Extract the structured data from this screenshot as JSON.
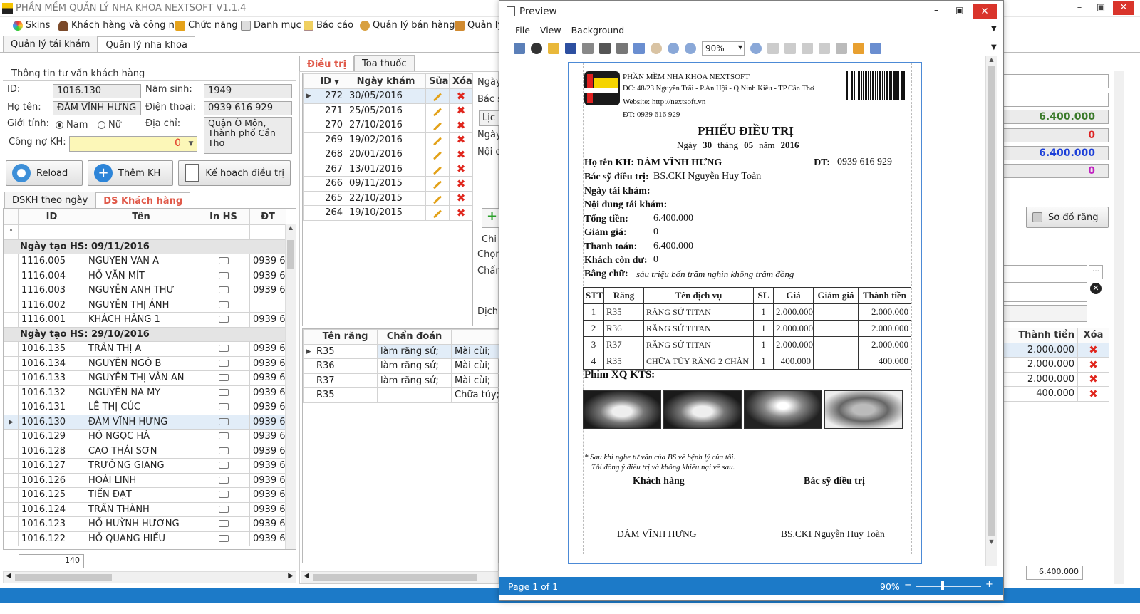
{
  "app": {
    "title": "PHẦN MỀM QUẢN LÝ NHA KHOA NEXTSOFT V1.1.4"
  },
  "menu": [
    "Skins",
    "Khách hàng và công nợ",
    "Chức năng",
    "Danh mục",
    "Báo cáo",
    "Quản lý bán hàng",
    "Quản lý"
  ],
  "main_tabs": [
    "Quản lý tái khám",
    "Quản lý nha khoa"
  ],
  "customer": {
    "section_title": "Thông tin tư vấn khách hàng",
    "id_label": "ID:",
    "id": "1016.130",
    "birth_label": "Năm sinh:",
    "birth": "1949",
    "name_label": "Họ tên:",
    "name": "ĐÀM VĨNH HƯNG",
    "phone_label": "Điện thoại:",
    "phone": "0939 616 929",
    "gender_label": "Giới tính:",
    "gender_male": "Nam",
    "gender_female": "Nữ",
    "address_label": "Địa chỉ:",
    "address": "Quận Ô Môn, Thành phố Cần Thơ",
    "debt_label": "Công nợ KH:",
    "debt": "0"
  },
  "buttons": {
    "reload": "Reload",
    "add_customer": "Thêm KH",
    "treatment_plan": "Kế hoạch điều trị",
    "tooth_chart": "Sơ đồ răng"
  },
  "list_tabs": [
    "DSKH theo ngày",
    "DS Khách hàng"
  ],
  "customer_grid": {
    "headers": [
      "ID",
      "Tên",
      "In HS",
      "ĐT"
    ],
    "groups": [
      {
        "label": "Ngày tạo HS: 09/11/2016",
        "rows": [
          [
            "1116.005",
            "NGUYEN VAN A",
            "0939 6"
          ],
          [
            "1116.004",
            "HỒ VĂN MÍT",
            "0939 6"
          ],
          [
            "1116.003",
            "NGUYỄN ANH THƯ",
            "0939 6"
          ],
          [
            "1116.002",
            "NGUYỄN THỊ ÁNH",
            ""
          ],
          [
            "1116.001",
            "KHÁCH HÀNG 1",
            "0939 6"
          ]
        ]
      },
      {
        "label": "Ngày tạo HS: 29/10/2016",
        "rows": [
          [
            "1016.135",
            "TRẦN THỊ A",
            "0939 6"
          ],
          [
            "1016.134",
            "NGUYỄN NGÔ B",
            "0939 6"
          ],
          [
            "1016.133",
            "NGUYỄN THỊ VÂN AN",
            "0939 6"
          ],
          [
            "1016.132",
            "NGUYỄN NA MY",
            "0939 6"
          ],
          [
            "1016.131",
            "LÊ THỊ CÚC",
            "0939 6"
          ],
          [
            "1016.130",
            "ĐÀM VĨNH HƯNG",
            "0939 6"
          ],
          [
            "1016.129",
            "HỒ NGỌC HÀ",
            "0939 6"
          ],
          [
            "1016.128",
            "CAO THÁI SƠN",
            "0939 6"
          ],
          [
            "1016.127",
            "TRƯỜNG GIANG",
            "0939 6"
          ],
          [
            "1016.126",
            "HOÀI LINH",
            "0939 6"
          ],
          [
            "1016.125",
            "TIẾN ĐẠT",
            "0939 6"
          ],
          [
            "1016.124",
            "TRẤN THÀNH",
            "0939 6"
          ],
          [
            "1016.123",
            "HỒ HUỲNH HƯƠNG",
            "0939 6"
          ],
          [
            "1016.122",
            "HỒ QUANG HIẾU",
            "0939 6"
          ]
        ]
      }
    ],
    "count": "140"
  },
  "treat_tabs": [
    "Điều trị",
    "Toa thuốc"
  ],
  "visit_grid": {
    "headers": [
      "ID",
      "Ngày khám",
      "Sửa",
      "Xóa"
    ],
    "rows": [
      [
        "272",
        "30/05/2016"
      ],
      [
        "271",
        "25/05/2016"
      ],
      [
        "270",
        "27/10/2016"
      ],
      [
        "269",
        "19/02/2016"
      ],
      [
        "268",
        "20/01/2016"
      ],
      [
        "267",
        "13/01/2016"
      ],
      [
        "266",
        "09/11/2015"
      ],
      [
        "265",
        "22/10/2015"
      ],
      [
        "264",
        "19/10/2015"
      ]
    ]
  },
  "partial_labels": [
    "Ngày",
    "Bác s",
    "Lịc",
    "Ngày",
    "Nội c",
    "Chi",
    "Chọn",
    "Chấn",
    "Dịch"
  ],
  "tooth_grid": {
    "headers": [
      "Tên răng",
      "Chẩn đoán"
    ],
    "rows": [
      [
        "R35",
        "làm răng sứ;",
        "Mài cùi;"
      ],
      [
        "R36",
        "làm răng sứ;",
        "Mài cùi;"
      ],
      [
        "R37",
        "làm răng sứ;",
        "Mài cùi;"
      ],
      [
        "R35",
        "",
        "Chữa tủy;"
      ]
    ]
  },
  "right_panel": {
    "totals": [
      "6.400.000",
      "0",
      "6.400.000",
      "0"
    ],
    "headers": [
      "Thành tiền",
      "Xóa"
    ],
    "amounts": [
      "2.000.000",
      "2.000.000",
      "2.000.000",
      "400.000"
    ],
    "footer_total": "6.400.000"
  },
  "preview": {
    "title": "Preview",
    "menu": [
      "File",
      "View",
      "Background"
    ],
    "zoom": "90%",
    "page": "Page 1 of 1",
    "status_zoom": "90%",
    "doc": {
      "clinic_name": "PHẦN MỀM NHA KHOA NEXTSOFT",
      "clinic_address": "ĐC: 48/23 Nguyễn Trãi - P.An Hội - Q.Ninh Kiều - TP.Cần Thơ",
      "clinic_web": "Website: http://nextsoft.vn",
      "clinic_phone": "ĐT: 0939 616 929",
      "heading": "PHIẾU ĐIỀU TRỊ",
      "date_ngay": "Ngày",
      "date_day": "30",
      "date_thang": "tháng",
      "date_month": "05",
      "date_nam": "năm",
      "date_year": "2016",
      "cust_label": "Họ tên KH: ĐÀM VĨNH HƯNG",
      "phone_label": "ĐT:",
      "phone": "0939 616 929",
      "doctor_label": "Bác sỹ điều trị:",
      "doctor": "BS.CKI Nguyễn Huy Toàn",
      "revisit_label": "Ngày tái khám:",
      "revisit_content_label": "Nội dung tái khám:",
      "total_label": "Tổng tiền:",
      "total": "6.400.000",
      "discount_label": "Giảm giá:",
      "discount": "0",
      "paid_label": "Thanh toán:",
      "paid": "6.400.000",
      "balance_label": "Khách còn dư:",
      "balance": "0",
      "words_label": "Bằng chữ:",
      "words": "sáu triệu bốn trăm nghìn không trăm đồng",
      "table_headers": [
        "STT",
        "Răng",
        "Tên dịch vụ",
        "SL",
        "Giá",
        "Giảm giá",
        "Thành tiền"
      ],
      "table_rows": [
        [
          "1",
          "R35",
          "RĂNG SỨ TITAN",
          "1",
          "2.000.000",
          "",
          "2.000.000"
        ],
        [
          "2",
          "R36",
          "RĂNG SỨ TITAN",
          "1",
          "2.000.000",
          "",
          "2.000.000"
        ],
        [
          "3",
          "R37",
          "RĂNG SỨ TITAN",
          "1",
          "2.000.000",
          "",
          "2.000.000"
        ],
        [
          "4",
          "R35",
          "CHỮA TỦY RĂNG 2 CHÂN",
          "1",
          "400.000",
          "",
          "400.000"
        ]
      ],
      "xray_label": "Phim XQ KTS:",
      "note1": "* Sau khi nghe tư vấn của BS về bệnh lý của tôi.",
      "note2": "Tôi đồng ý điều trị và không khiếu nại về sau.",
      "sig_customer": "Khách hàng",
      "sig_doctor": "Bác sỹ điều trị",
      "sig_customer_name": "ĐÀM VĨNH HƯNG",
      "sig_doctor_name": "BS.CKI Nguyễn Huy Toàn"
    }
  }
}
